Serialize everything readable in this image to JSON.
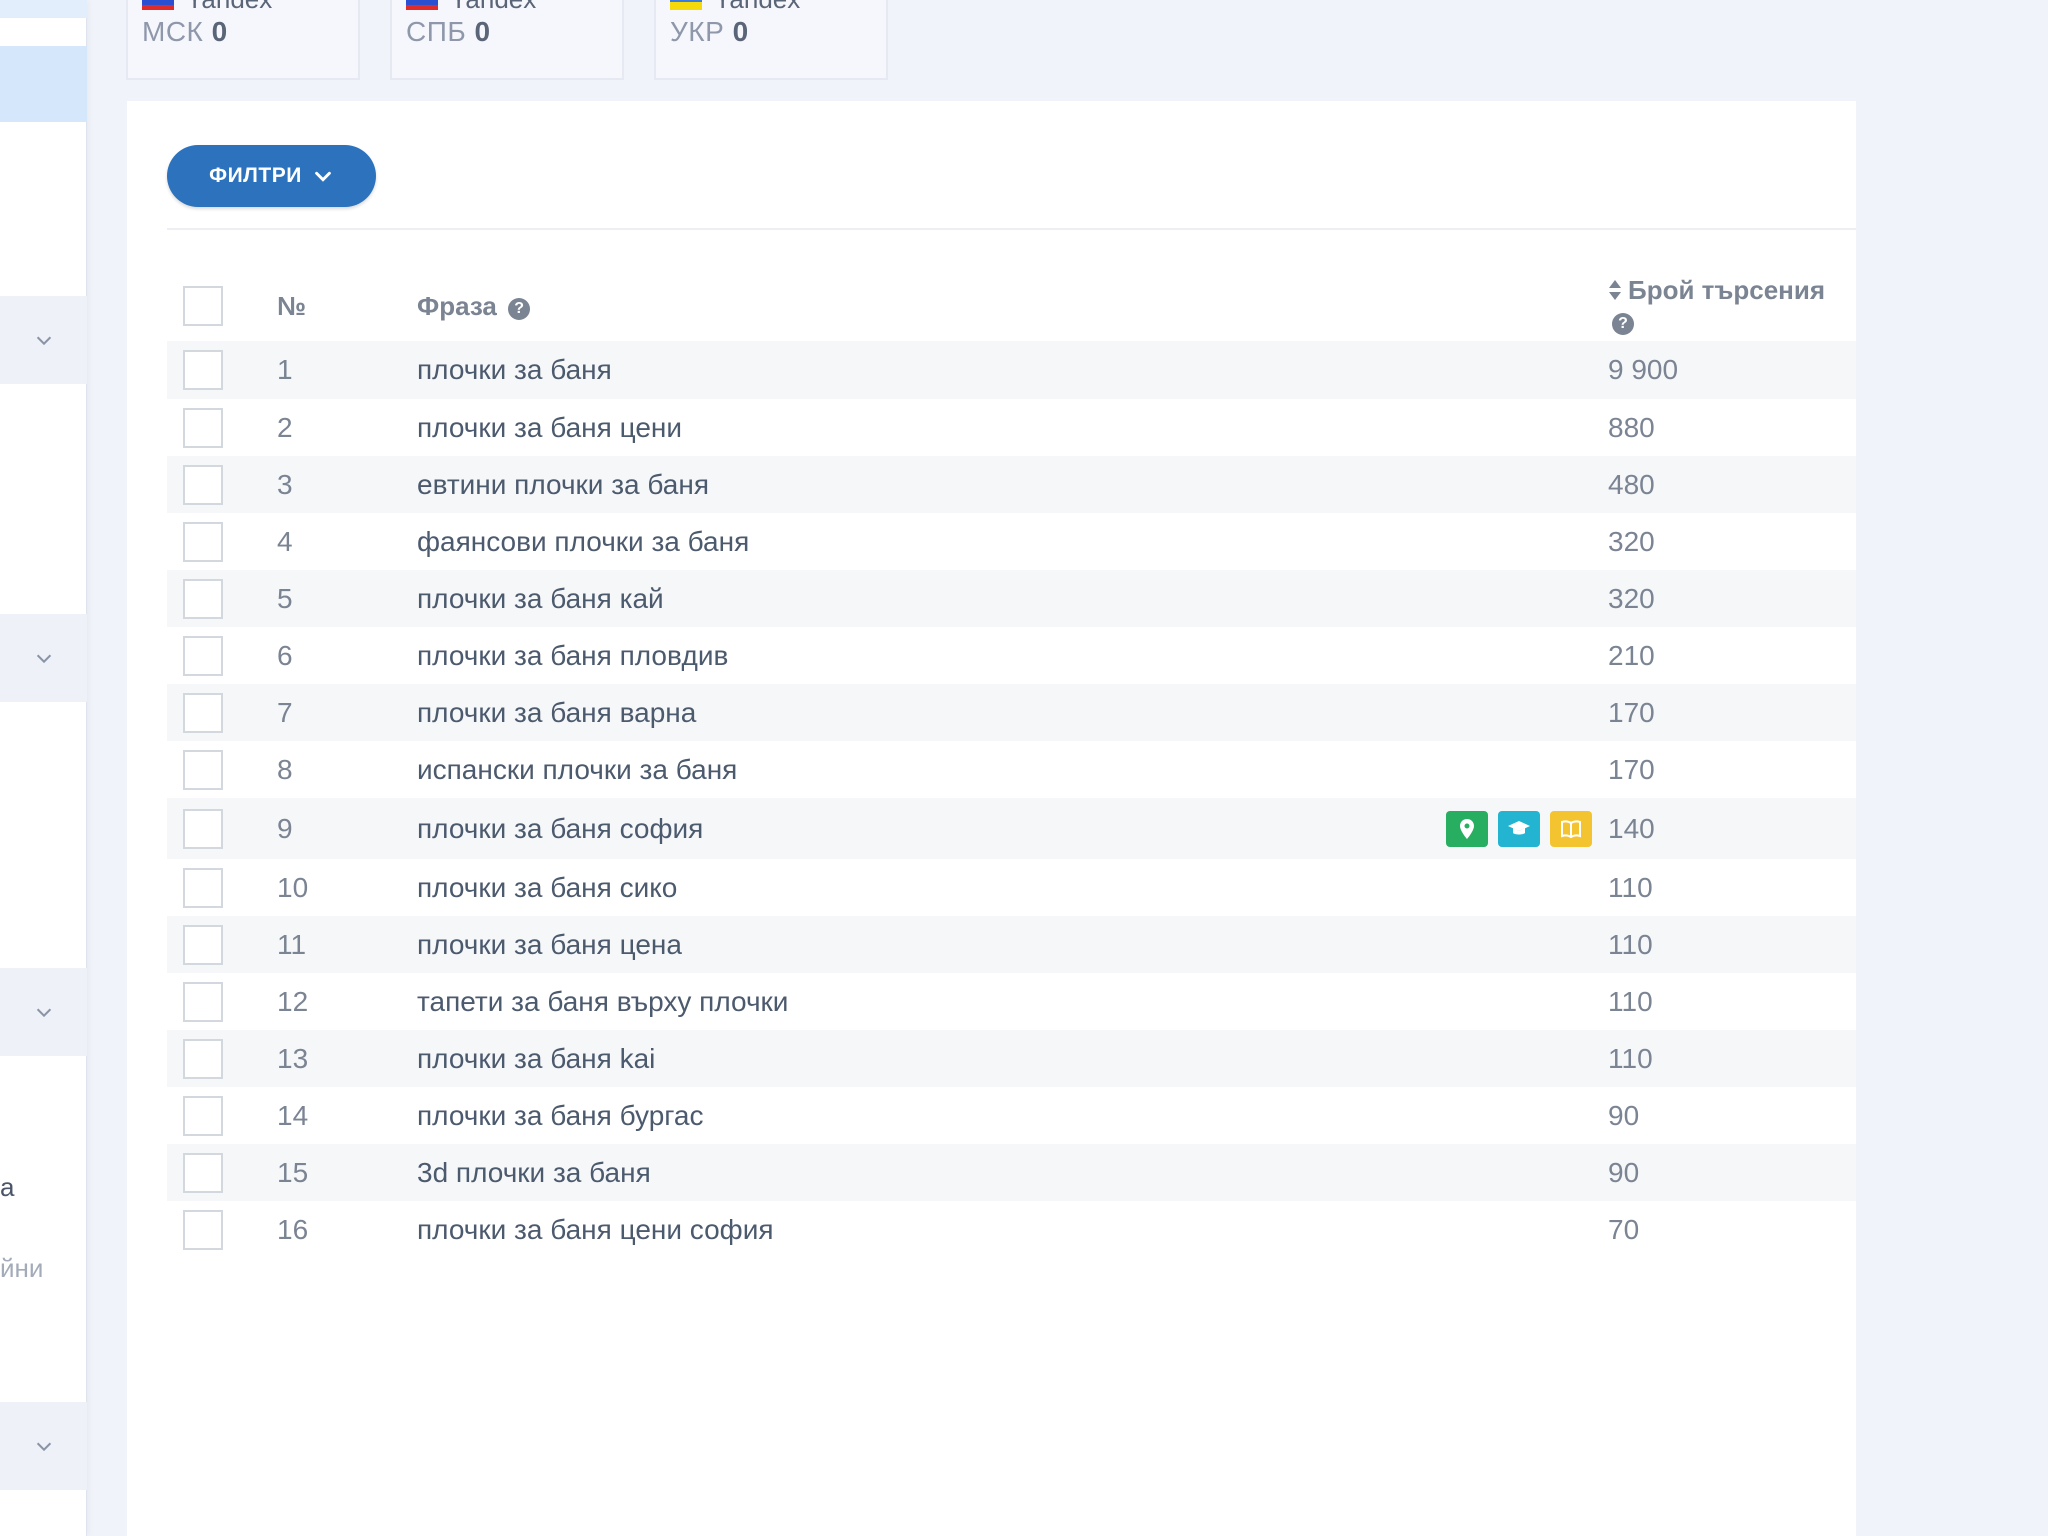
{
  "cards": [
    {
      "brand": "Yandex",
      "label": "МСК",
      "value": "0"
    },
    {
      "brand": "Yandex",
      "label": "СПБ",
      "value": "0"
    },
    {
      "brand": "Yandex",
      "label": "УКР",
      "value": "0"
    }
  ],
  "sidebar": {
    "fragments": [
      "а",
      "йни"
    ]
  },
  "toolbar": {
    "filters_label": "ФИЛТРИ"
  },
  "table": {
    "columns": {
      "number": "№",
      "phrase": "Фраза",
      "count": "Брой търсения"
    },
    "rows": [
      {
        "n": "1",
        "phrase": "плочки за баня",
        "count": "9 900"
      },
      {
        "n": "2",
        "phrase": "плочки за баня цени",
        "count": "880"
      },
      {
        "n": "3",
        "phrase": "евтини плочки за баня",
        "count": "480"
      },
      {
        "n": "4",
        "phrase": "фаянсови плочки за баня",
        "count": "320"
      },
      {
        "n": "5",
        "phrase": "плочки за баня кай",
        "count": "320"
      },
      {
        "n": "6",
        "phrase": "плочки за баня пловдив",
        "count": "210"
      },
      {
        "n": "7",
        "phrase": "плочки за баня варна",
        "count": "170"
      },
      {
        "n": "8",
        "phrase": "испански плочки за баня",
        "count": "170"
      },
      {
        "n": "9",
        "phrase": "плочки за баня софия",
        "count": "140",
        "badges": [
          "map-pin-icon",
          "graduation-cap-icon",
          "book-icon"
        ]
      },
      {
        "n": "10",
        "phrase": "плочки за баня сико",
        "count": "110"
      },
      {
        "n": "11",
        "phrase": "плочки за баня цена",
        "count": "110"
      },
      {
        "n": "12",
        "phrase": "тапети за баня върху плочки",
        "count": "110"
      },
      {
        "n": "13",
        "phrase": "плочки за баня kai",
        "count": "110"
      },
      {
        "n": "14",
        "phrase": "плочки за баня бургас",
        "count": "90"
      },
      {
        "n": "15",
        "phrase": "3d плочки за баня",
        "count": "90"
      },
      {
        "n": "16",
        "phrase": "плочки за баня цени софия",
        "count": "70"
      }
    ]
  },
  "colors": {
    "accent": "#2c72bd",
    "badge_green": "#27ae60",
    "badge_teal": "#23b4d1",
    "badge_yellow": "#f4c430"
  }
}
